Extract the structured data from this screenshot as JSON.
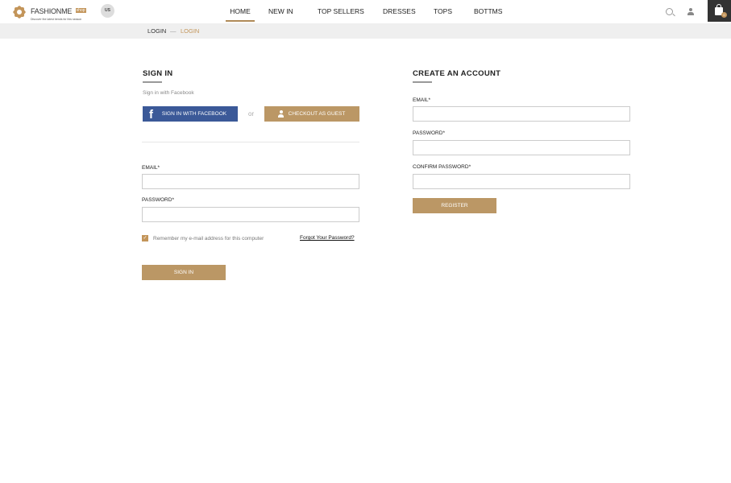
{
  "header": {
    "logo_name": "FASHIONME",
    "logo_badge": "shop",
    "logo_tagline": "Discover the latest trends for this season",
    "region": "US",
    "nav": [
      "HOME",
      "NEW IN",
      "TOP SELLERS",
      "DRESSES",
      "TOPS",
      "BOTTMS"
    ],
    "active_nav": "HOME",
    "cart_count": "0"
  },
  "breadcrumb": {
    "items": [
      "LOGIN",
      "LOGIN"
    ],
    "separator": "—"
  },
  "signin": {
    "title": "SIGN IN",
    "facebook_hint": "Sign in with Facebook",
    "facebook_button": "SIGN IN WITH FACEBOOK",
    "or": "or",
    "guest_button": "CHECKOUT AS GUEST",
    "email_label": "EMAIL*",
    "email_value": "",
    "password_label": "PASSWORD*",
    "password_value": "",
    "remember_label": "Remember my e-mail address for this computer",
    "remember_checked": true,
    "forgot_link": "Forgot Your Password?",
    "submit": "SIGN IN"
  },
  "register": {
    "title": "CREATE AN ACCOUNT",
    "email_label": "EMAIL*",
    "password_label": "PASSWORD*",
    "confirm_label": "CONFIRM PASSWORD*",
    "submit": "REGISTER"
  },
  "colors": {
    "accent": "#bb9765",
    "facebook": "#3b5998",
    "breadcrumb_active": "#c3955a"
  }
}
